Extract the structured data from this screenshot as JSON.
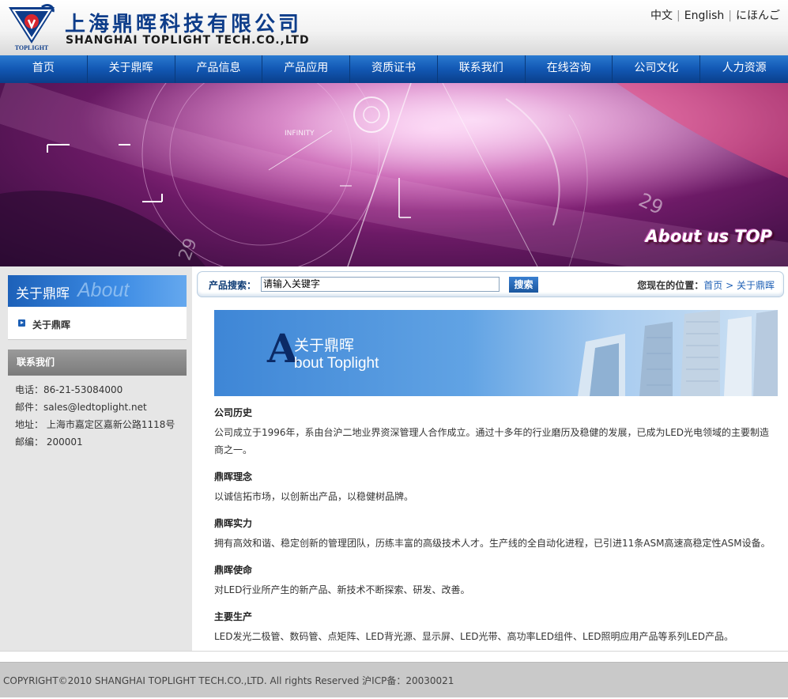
{
  "header": {
    "logo_cn": "上海鼎晖科技有限公司",
    "logo_en": "SHANGHAI TOPLIGHT TECH.CO.,LTD",
    "logo_mark_text": "TOPLIGHT",
    "languages": [
      "中文",
      "English",
      "にほんご"
    ]
  },
  "nav": {
    "items": [
      "首页",
      "关于鼎晖",
      "产品信息",
      "产品应用",
      "资质证书",
      "联系我们",
      "在线咨询",
      "公司文化",
      "人力资源"
    ]
  },
  "banner": {
    "tagline": "About us TOP",
    "small_text": "INFINITY",
    "numbers": [
      "29",
      "29"
    ]
  },
  "sidebar": {
    "title": "关于鼎晖",
    "title_bg": "About",
    "menu": [
      "关于鼎晖"
    ],
    "contact_title": "联系我们",
    "contact": [
      "电话：86-21-53084000",
      "邮件：sales@ledtoplight.net",
      "地址： 上海市嘉定区嘉新公路1118号",
      "邮编： 200001"
    ]
  },
  "search": {
    "label": "产品搜索：",
    "value": "请输入关键字",
    "button": "搜索"
  },
  "breadcrumb": {
    "prefix": "您现在的位置：",
    "home": "首页",
    "current": "> 关于鼎晖"
  },
  "about_banner": {
    "letter": "A",
    "cn": "关于鼎晖",
    "en": "bout Toplight"
  },
  "sections": [
    {
      "title": "公司历史",
      "body": "公司成立于1996年，系由台沪二地业界资深管理人合作成立。通过十多年的行业磨历及稳健的发展，已成为LED光电领域的主要制造商之一。"
    },
    {
      "title": "鼎晖理念",
      "body": "以诚信拓市场，以创新出产品，以稳健树品牌。"
    },
    {
      "title": "鼎晖实力",
      "body": "拥有高效和谐、稳定创新的管理团队，历练丰富的高级技术人才。生产线的全自动化进程，已引进11条ASM高速高稳定性ASM设备。"
    },
    {
      "title": "鼎晖使命",
      "body": "对LED行业所产生的新产品、新技术不断探索、研发、改善。"
    },
    {
      "title": "主要生产",
      "body": "LED发光二极管、数码管、点矩阵、LED背光源、显示屏、LED光带、高功率LED组件、LED照明应用产品等系列LED产品。"
    }
  ],
  "footer": {
    "text": "COPYRIGHT©2010 SHANGHAI TOPLIGHT TECH.CO.,LTD. All rights Reserved 沪ICP备：20030021"
  }
}
